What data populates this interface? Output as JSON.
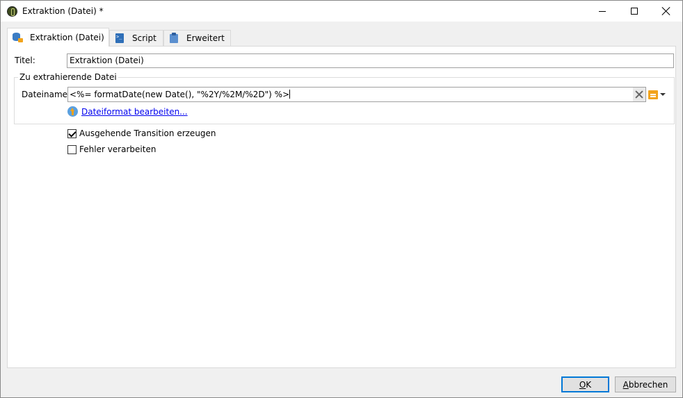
{
  "window": {
    "title": "Extraktion (Datei) *",
    "controls": {
      "minimize": "minimize-icon",
      "maximize": "maximize-icon",
      "close": "close-icon"
    }
  },
  "tabs": [
    {
      "label": "Extraktion (Datei)",
      "icon": "database-icon",
      "active": true
    },
    {
      "label": "Script",
      "icon": "script-icon",
      "active": false
    },
    {
      "label": "Erweitert",
      "icon": "clipboard-icon",
      "active": false
    }
  ],
  "form": {
    "title_label": "Titel:",
    "title_value": "Extraktion (Datei)",
    "group_label": "Zu extrahierende Datei",
    "file_label": "Dateiname:",
    "file_value": "<%= formatDate(new Date(), \"%2Y/%2M/%2D\") %>",
    "format_link": "Dateiformat bearbeiten...",
    "checkboxes": [
      {
        "label": "Ausgehende Transition erzeugen",
        "checked": true
      },
      {
        "label": "Fehler verarbeiten",
        "checked": false
      }
    ]
  },
  "buttons": {
    "ok_mnemonic": "O",
    "ok_rest": "K",
    "cancel_mnemonic": "A",
    "cancel_rest": "bbrechen"
  },
  "colors": {
    "accent": "#0078d7",
    "link": "#0000ee",
    "icon_orange": "#f2a31b",
    "icon_blue": "#3b7cc4"
  }
}
